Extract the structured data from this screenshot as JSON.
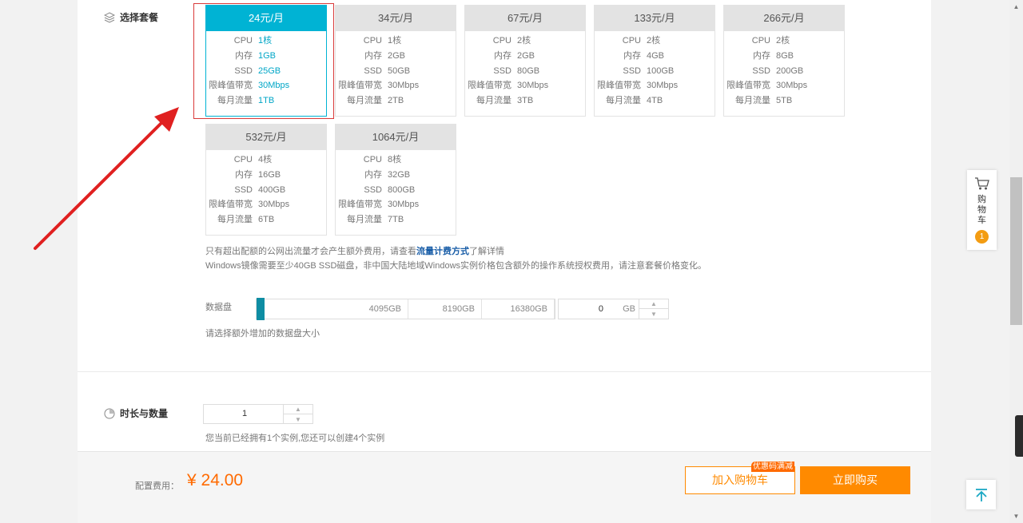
{
  "sections": {
    "plan_label": "选择套餐",
    "duration_label": "时长与数量"
  },
  "plans": [
    {
      "price": "24元/月",
      "cpu": "1核",
      "mem": "1GB",
      "ssd": "25GB",
      "bw": "30Mbps",
      "traffic": "1TB",
      "selected": true
    },
    {
      "price": "34元/月",
      "cpu": "1核",
      "mem": "2GB",
      "ssd": "50GB",
      "bw": "30Mbps",
      "traffic": "2TB"
    },
    {
      "price": "67元/月",
      "cpu": "2核",
      "mem": "2GB",
      "ssd": "80GB",
      "bw": "30Mbps",
      "traffic": "3TB"
    },
    {
      "price": "133元/月",
      "cpu": "2核",
      "mem": "4GB",
      "ssd": "100GB",
      "bw": "30Mbps",
      "traffic": "4TB"
    },
    {
      "price": "266元/月",
      "cpu": "2核",
      "mem": "8GB",
      "ssd": "200GB",
      "bw": "30Mbps",
      "traffic": "5TB"
    },
    {
      "price": "532元/月",
      "cpu": "4核",
      "mem": "16GB",
      "ssd": "400GB",
      "bw": "30Mbps",
      "traffic": "6TB"
    },
    {
      "price": "1064元/月",
      "cpu": "8核",
      "mem": "32GB",
      "ssd": "800GB",
      "bw": "30Mbps",
      "traffic": "7TB"
    }
  ],
  "spec_keys": {
    "cpu": "CPU",
    "mem": "内存",
    "ssd": "SSD",
    "bw": "限峰值带宽",
    "traffic": "每月流量"
  },
  "notes": {
    "traffic_prefix": "只有超出配额的公网出流量才会产生额外费用，请查看",
    "traffic_link": "流量计费方式",
    "traffic_suffix": "了解详情",
    "windows": "Windows镜像需要至少40GB SSD磁盘，非中国大陆地域Windows实例价格包含额外的操作系统授权费用，请注意套餐价格变化。"
  },
  "disk": {
    "label": "数据盘",
    "marks": [
      "4095GB",
      "8190GB",
      "16380GB"
    ],
    "value": "0",
    "unit": "GB",
    "hint": "请选择额外增加的数据盘大小"
  },
  "duration": {
    "quantity": "1",
    "hint": "您当前已经拥有1个实例,您还可以创建4个实例"
  },
  "footer": {
    "fee_label": "配置费用：",
    "fee_value": "¥ 24.00",
    "coupon": "优惠码满减",
    "add_cart": "加入购物车",
    "buy_now": "立即购买"
  },
  "cart_widget": {
    "label": "购物车",
    "count": "1"
  },
  "colors": {
    "accent": "#00b3d4",
    "orange": "#ff8a00",
    "price": "#ff6a00",
    "annotation_red": "#e02020"
  },
  "icons": [
    "cube-icon",
    "clock-icon",
    "cart-icon",
    "arrow-up-icon",
    "annotation-arrow-icon"
  ]
}
